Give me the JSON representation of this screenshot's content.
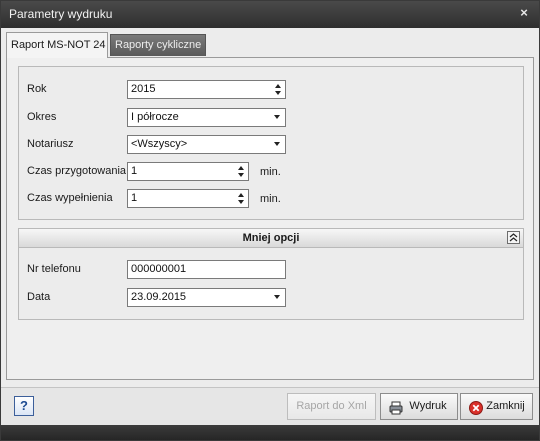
{
  "window": {
    "title": "Parametry wydruku",
    "close_glyph": "×"
  },
  "tabs": [
    {
      "label": "Raport MS-NOT 24",
      "active": true
    },
    {
      "label": "Raporty cykliczne",
      "active": false
    }
  ],
  "form": {
    "rok": {
      "label": "Rok",
      "value": "2015"
    },
    "okres": {
      "label": "Okres",
      "value": "I półrocze"
    },
    "notariusz": {
      "label": "Notariusz",
      "value": "<Wszyscy>"
    },
    "czas_przygotowania": {
      "label": "Czas przygotowania",
      "value": "1",
      "unit": "min."
    },
    "czas_wypelnienia": {
      "label": "Czas wypełnienia",
      "value": "1",
      "unit": "min."
    }
  },
  "section": {
    "title": "Mniej opcji",
    "collapse_icon": "double-chevron-up-icon",
    "nr_telefonu": {
      "label": "Nr telefonu",
      "value": "000000001"
    },
    "data": {
      "label": "Data",
      "value": "23.09.2015"
    }
  },
  "buttons": {
    "help": "?",
    "raport_xml": "Raport do Xml",
    "wydruk": "Wydruk",
    "zamknij": "Zamknij"
  },
  "colors": {
    "close_button_red": "#d9302a",
    "help_blue": "#1d4b92"
  }
}
